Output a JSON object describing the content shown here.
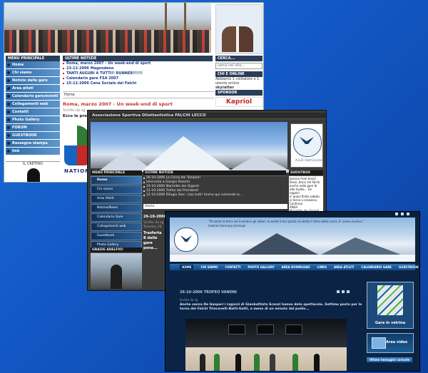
{
  "window1": {
    "menu_header": "MENU PRINCIPALE",
    "menu": [
      "Home",
      "Chi siamo",
      "Notizie dalle gare",
      "Area atleti",
      "Calendario gare/eventi",
      "Collegamenti web",
      "Contatti",
      "Photo Gallery",
      "FORUM",
      "GUESTBOOK",
      "Rassegna stampa",
      "link"
    ],
    "news_header": "ULTIME NOTIZIE",
    "news": [
      "Roma, marzo 2007 - Un week-end di sport",
      "23-12-2006 Magnodeno",
      "TANTI AUGURI A TUTTI!! RUNNER!!!!!!",
      "Calendario gare FSA 2007",
      "15-12-2006 Cena Sociale dei Falchi"
    ],
    "breadcrumb": "Home",
    "article_title": "Roma, marzo 2007 - Un week-end di sport",
    "article_sub": "Scritto da sg",
    "article_text": "Ecco le propo",
    "logo_text": "NATION",
    "search_header": "CERCA...",
    "search_placeholder": "cerca nel sito...",
    "online_header": "CHI E ONLINE",
    "online_text": "Abbiamo 1 visitatore e 1 utente online",
    "online_user": "skyratter",
    "sponsor_header": "SPONSOR",
    "sponsor_name": "Kapriol",
    "cretino_label": "IL CRETINO"
  },
  "window2": {
    "title": "Associazione Sportiva Dilettantistica FALCHI LECCO",
    "emblem_text": "A.S.D. Falchi Lecco",
    "menu_header": "MENU PRINCIPALE",
    "menu": [
      "Home",
      "Chi siamo",
      "Area Atleti",
      "Notizie/News",
      "Calendario Gare",
      "Collegamenti web",
      "Guestbook",
      "Photo Gallery",
      "Contatti"
    ],
    "news_header": "ULTIME NOTIZIE",
    "news": [
      "26-10-2006 La Corsa dei Templari",
      "Intervista a Giorgio Pesenti",
      "19-10-2006 Marmitte dei Giganti",
      "12-10-2006 Trofeo dei Presidenti",
      "12-10-2006 Rifugio Stoc: ciao tutti! Anche qui comando io..."
    ],
    "breadcrumb": "Home",
    "article_date": "26-10-2006",
    "article_sub": "Scritto da sg",
    "article_sub2": "Tuesday 26",
    "article_text": "Trasferta B delle gare pena...",
    "shout_header": "SHOUTBOX",
    "shout": [
      "barone from brezil",
      "Bravi, bravi siti falchi anche nelle gare di alto livello... Un regalo!",
      "e' quasi finita sabato si torna a cassassa",
      "Continua",
      "ANSA",
      "Marmitte dei Giganti: FALCHI \"Sq. A\" (Salti-Batti-Trincavelli) sul 2°"
    ],
    "grazie_header": "GRAZIE ADELFIO!"
  },
  "window3": {
    "quote": "\"Te sento la terra sul il vento e gli alberi. Io sento il tuo spirito. Io sento il ritmo della corsa. E' come musica.\"",
    "quote_author": "Gabriel Harmony Jennings",
    "nav": [
      "HOME",
      "CHI SIAMO",
      "CONTATTI",
      "PHOTO GALLERY",
      "AREA DOWNLOAD",
      "LINKS",
      "AREA ATLETI",
      "CALENDARIO GARE",
      "GUESTBOOK"
    ],
    "post_title": "26-10-2006 TROFEO VANONI",
    "post_sub": "Scritto da sg",
    "post_text": "Anche senza De Gasperi i ragazzi di Gianbattista Scanzi hanno dato spettacolo. Settimo posto per la terna dei Falchi Trincavelli-Batti-Gatti, a meno di un minuto dal podio...",
    "vetrina_label": "Gare in vetrina",
    "video_label": "Area video",
    "ultime_label": "Ultime immagini caricate"
  }
}
